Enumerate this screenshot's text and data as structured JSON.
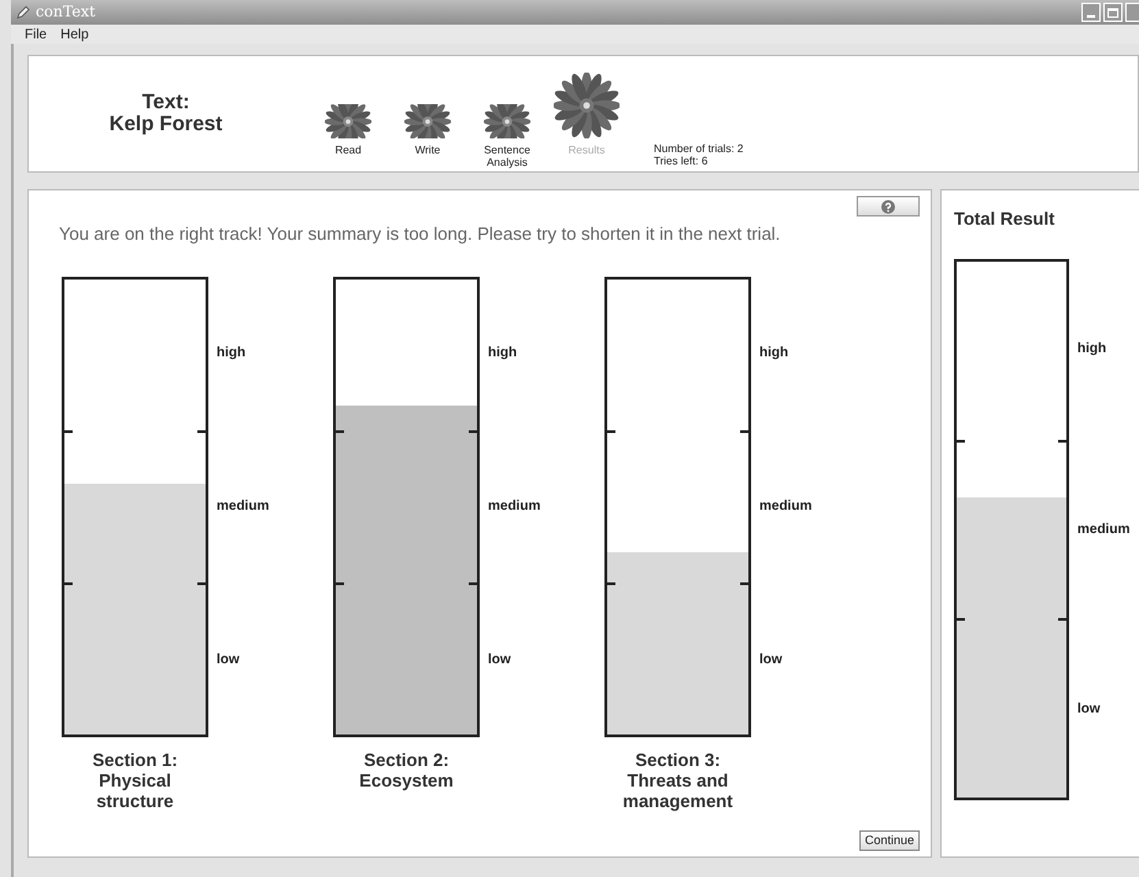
{
  "window": {
    "title": "conText"
  },
  "menu": [
    "File",
    "Help"
  ],
  "header": {
    "text_label": "Text:",
    "text_title": "Kelp Forest",
    "steps": [
      {
        "label": "Read",
        "selected": false
      },
      {
        "label": "Write",
        "selected": false
      },
      {
        "label": "Sentence Analysis",
        "selected": false
      },
      {
        "label": "Results",
        "selected": true
      }
    ],
    "trials": "Number of trials: 2",
    "tries_left": "Tries left: 6"
  },
  "message": "You are on the right track! Your summary is too long. Please try to shorten it in the next trial.",
  "sections": [
    {
      "title": "Section 1:",
      "subtitle": "Physical structure",
      "level": 0.55,
      "color": "#d9d9d9",
      "scale_labels": [
        "high",
        "medium",
        "low"
      ]
    },
    {
      "title": "Section 2:",
      "subtitle": "Ecosystem",
      "level": 0.72,
      "color": "#bfbfbf",
      "scale_labels": [
        "high",
        "medium",
        "low"
      ]
    },
    {
      "title": "Section 3:",
      "subtitle": "Threats and management",
      "level": 0.4,
      "color": "#d9d9d9",
      "scale_labels": [
        "high",
        "medium",
        "low"
      ]
    }
  ],
  "continue_button": "Continue",
  "total": {
    "title": "Total Result",
    "level": 0.56,
    "color": "#d9d9d9",
    "scale_labels": [
      "high",
      "medium",
      "low"
    ]
  }
}
